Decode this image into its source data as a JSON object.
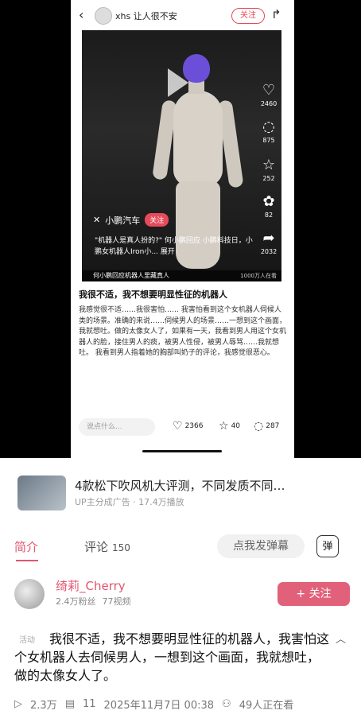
{
  "post": {
    "back_icon": "‹",
    "title": "xhs 让人很不安",
    "follow_label": "关注",
    "share_icon": "↱"
  },
  "video": {
    "brand": "小鹏汽车",
    "brand_follow": "关注",
    "caption": "\"机器人是真人扮的?\" 何小鹏回应 小鹏科技日，小鹏女机器人Iron小... 展开",
    "bottom_text": "何小鹏回应机器人里藏真人",
    "play_count": "1000万人在看",
    "likes": "2460",
    "comments": "875",
    "favorites": "252",
    "shares_a": "82",
    "shares_b": "2032"
  },
  "note": {
    "title": "我很不适，我不想要明显性征的机器人",
    "body": "我感觉很不适……我很害怕…… 我害怕看到这个女机器人伺候人类的场景。准确的来说……伺候男人的场景……一想到这个画面，我就想吐。做的太像女人了，如果有一天，我看到男人用这个女机器人的脸，接住男人的痰，被男人性侵，被男人辱骂……我就想吐。 我看到男人指着她的胸部叫奶子的评论，我感觉很恶心。",
    "comment_placeholder": "说点什么...",
    "likes": "2366",
    "stars": "40",
    "comments": "287"
  },
  "ad": {
    "title": "4款松下吹风机大评测，不同发质不同…",
    "sub": "UP主分成广告 · 17.4万播放"
  },
  "tabs": {
    "intro": "简介",
    "comment": "评论",
    "comment_count": "150",
    "danmu": "点我发弹幕",
    "danmu_btn": "弹"
  },
  "author": {
    "name": "绮莉_Cherry",
    "fans": "2.4万粉丝",
    "videos": "77视频",
    "follow": "+ 关注"
  },
  "video_info": {
    "activity": "活动",
    "title": "我很不适，我不想要明显性征的机器人，我害怕这个女机器人去伺候男人，一想到这个画面，我就想吐，做的太像女人了。",
    "views": "2.3万",
    "danmaku": "11",
    "date": "2025年11月7日 00:38",
    "watching": "49人正在看"
  },
  "colors": {
    "accent": "#e2556f",
    "follow_red": "#e74a5a"
  }
}
